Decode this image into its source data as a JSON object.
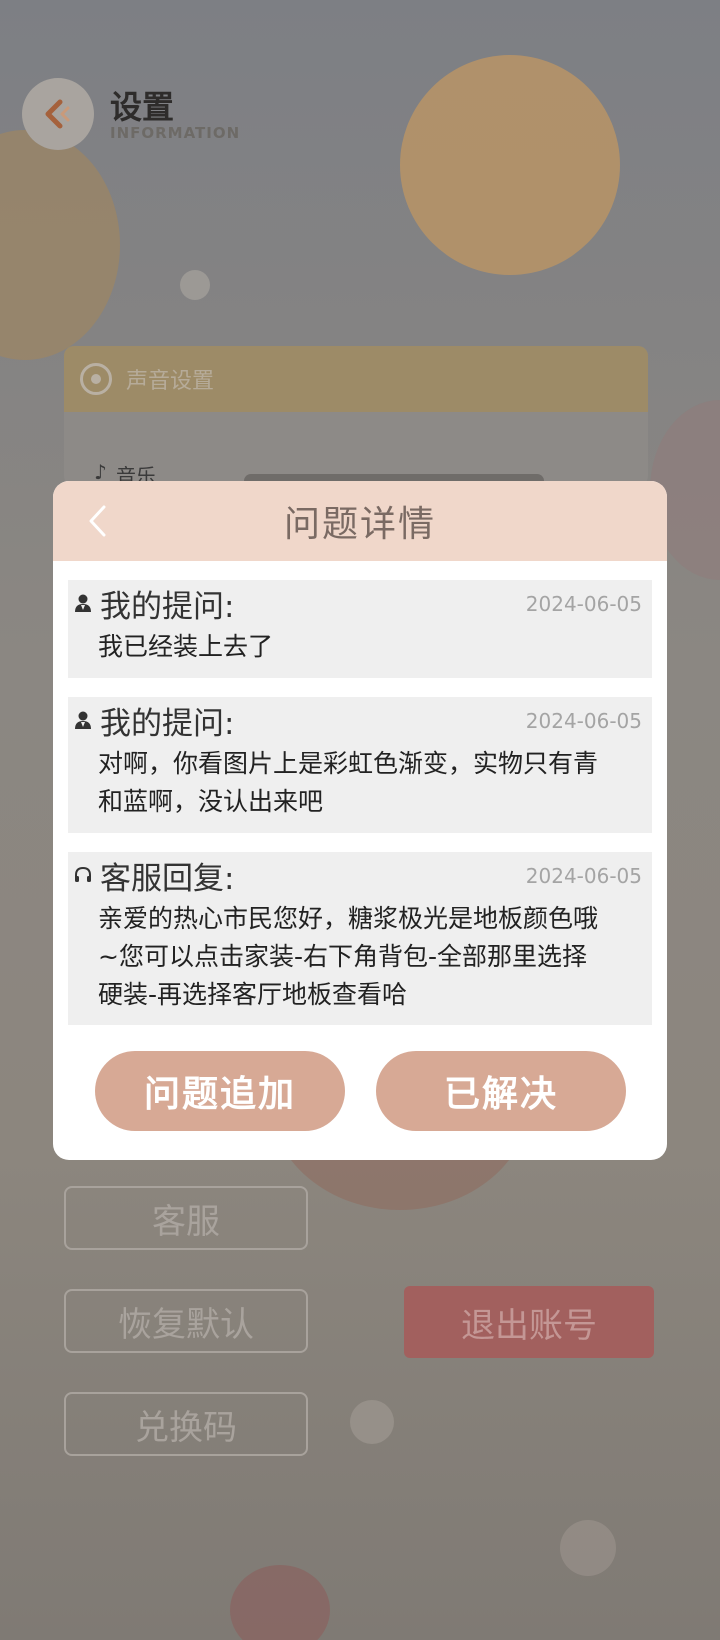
{
  "background": {
    "title": "设置",
    "subtitle": "INFORMATION",
    "sound_card": {
      "header": "声音设置",
      "music_label": "音乐"
    },
    "buttons": {
      "customer_service": "客服",
      "restore_default": "恢复默认",
      "redeem_code": "兑换码",
      "logout": "退出账号"
    }
  },
  "dialog": {
    "title": "问题详情",
    "messages": [
      {
        "author": "我的提问:",
        "date": "2024-06-05",
        "icon": "user-icon",
        "text": "我已经装上去了"
      },
      {
        "author": "我的提问:",
        "date": "2024-06-05",
        "icon": "user-icon",
        "text": "对啊，你看图片上是彩虹色渐变，实物只有青和蓝啊，没认出来吧"
      },
      {
        "author": "客服回复:",
        "date": "2024-06-05",
        "icon": "headset-icon",
        "text": "亲爱的热心市民您好，糖浆极光是地板颜色哦~您可以点击家装-右下角背包-全部那里选择硬装-再选择客厅地板查看哈"
      }
    ],
    "buttons": {
      "append": "问题追加",
      "solved": "已解决"
    }
  },
  "colors": {
    "dialog_header_bg": "#f0d7ca",
    "button_bg": "#d7a995",
    "message_bg": "#efefef"
  }
}
